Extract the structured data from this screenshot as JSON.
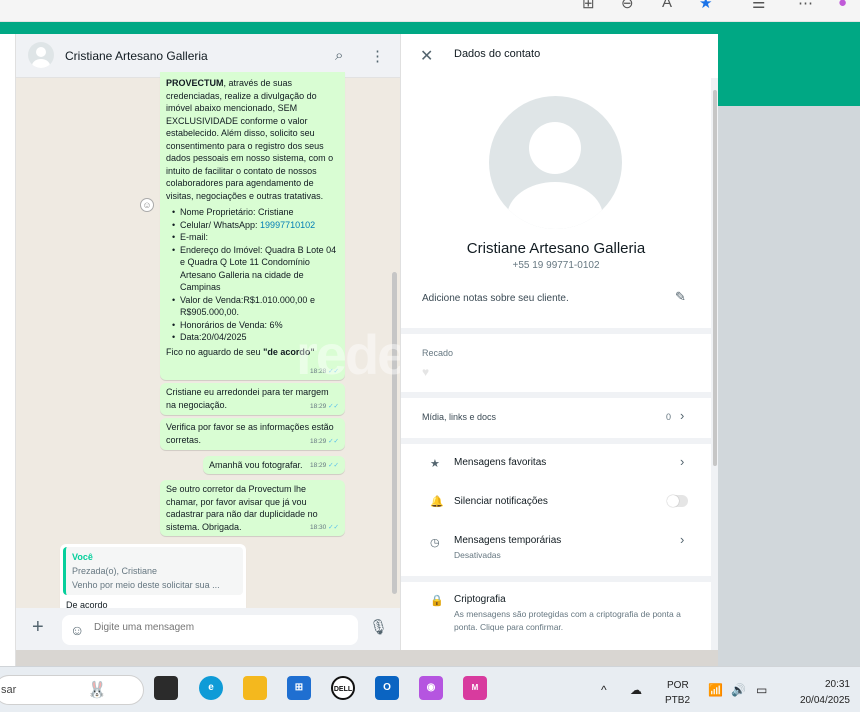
{
  "browser": {
    "icons": [
      "split-screen-icon",
      "zoom-icon",
      "read-aloud-icon",
      "favorite-star-icon",
      "favorites-list-icon",
      "more-icon",
      "copilot-icon"
    ]
  },
  "chat": {
    "contact_name": "Cristiane Artesano Galleria",
    "messages": {
      "long": {
        "intro_bold": "PROVECTUM",
        "intro_rest": ", através de suas credenciadas, realize a divulgação do imóvel abaixo mencionado, SEM EXCLUSIVIDADE conforme o valor estabelecido. Além disso, solicito seu consentimento para o registro dos seus dados pessoais em nosso sistema, com o intuito de facilitar o contato de nossos colaboradores para agendamento de visitas, negociações e outras tratativas.",
        "bullets": {
          "owner": "Nome Proprietário: Cristiane",
          "phone_label": "Celular/ WhatsApp: ",
          "phone": "19997710102",
          "email": "E-mail:",
          "address": "Endereço do Imóvel: Quadra B Lote 04 e Quadra Q Lote 11 Condomínio Artesano Galleria na cidade de Campinas",
          "value": "Valor de Venda:R$1.010.000,00 e R$905.000,00.",
          "fees": "Honorários de Venda: 6%",
          "date": "Data:20/04/2025"
        },
        "closing_plain": "Fico no aguardo de seu ",
        "closing_bold": "\"de acordo\"",
        "time": "18:28"
      },
      "m2": {
        "text": "Cristiane eu arredondei para ter margem na negociação.",
        "time": "18:29"
      },
      "m3": {
        "text": "Verifica por favor se as informações estão corretas.",
        "time": "18:29"
      },
      "m4": {
        "text": "Amanhã vou fotografar.",
        "time": "18:29"
      },
      "m5": {
        "text": "Se outro corretor da Provectum lhe chamar, por favor avisar que já vou cadastrar para não dar duplicidade no sistema. Obrigada.",
        "time": "18:30"
      },
      "reply": {
        "quote_author": "Você",
        "quote_line1": "Prezada(o), Cristiane",
        "quote_line2": "Venho por meio deste solicitar sua ...",
        "text": "De acordo"
      }
    },
    "composer_placeholder": "Digite uma mensagem"
  },
  "panel": {
    "title": "Dados do contato",
    "name": "Cristiane Artesano Galleria",
    "phone": "+55 19 99771-0102",
    "notes": "Adicione notas sobre seu cliente.",
    "recado_label": "Recado",
    "media_label": "Mídia, links e docs",
    "media_count": "0",
    "starred": "Mensagens favoritas",
    "mute": "Silenciar notificações",
    "temporary": "Mensagens temporárias",
    "temporary_sub": "Desativadas",
    "crypto": "Criptografia",
    "crypto_sub": "As mensagens são protegidas com a criptografia de ponta a ponta. Clique para confirmar."
  },
  "watermark": "rede",
  "taskbar": {
    "search": "sar",
    "lang1": "POR",
    "lang2": "PTB2",
    "time": "20:31",
    "date": "20/04/2025",
    "apps": [
      "task-view-icon",
      "edge-icon",
      "file-explorer-icon",
      "store-icon",
      "dell-icon",
      "outlook-icon",
      "copilot-icon",
      "m365-icon"
    ]
  },
  "colors": {
    "wa_green": "#00a884",
    "bubble": "#d9fdd3",
    "link": "#027eb5"
  }
}
